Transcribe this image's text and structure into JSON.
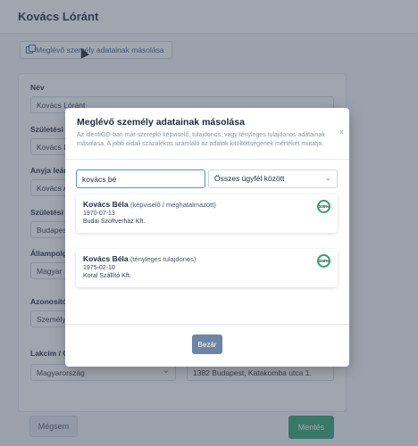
{
  "page": {
    "title": "Kovács Lóránt",
    "copy_button_label": "Meglévő személy adatainak másolása"
  },
  "form": {
    "fields": [
      {
        "label": "Név",
        "value": "Kovács Lóránt"
      },
      {
        "label": "Születési ne",
        "value": "Kovács Lo"
      },
      {
        "label": "Anyja leány",
        "value": "Kovács A"
      },
      {
        "label": "Születési he",
        "value": "Budapest"
      },
      {
        "label": "Állampolgá",
        "value": "Magyar"
      },
      {
        "label": "Azonosító d",
        "value": "Személyi"
      }
    ],
    "address": {
      "label": "Lakcím / O",
      "country": "Magyarország",
      "street": "1382 Budapest, Katakomba utca 1."
    },
    "cancel_label": "Mégsem",
    "save_label": "Mentés"
  },
  "modal": {
    "title": "Meglévő személy adatainak másolása",
    "close_symbol": "×",
    "description": "Az identiGO-ban már szereplő képviselő, tulajdonos, vagy tényleges tulajdonos adatainak másolása. A jobb oldali százalékos számláló az adatok kitöltöttségének mértékét mutatja.",
    "search_value": "kovács bé",
    "scope_value": "Összes ügyfél között",
    "results": [
      {
        "name": "Kovács Béla",
        "role": "(képviselő / meghatalmazott)",
        "date": "1970-07-13",
        "company": "Budai Szoftverház Kft.",
        "percent": "100%"
      },
      {
        "name": "Kovács Béla",
        "role": "(tényleges tulajdonos)",
        "date": "1975-02-10",
        "company": "Koral Szállító Kft.",
        "percent": "100%"
      }
    ],
    "close_button_label": "Bezár"
  },
  "colors": {
    "accent": "#2ca36a",
    "primary_button": "#6c84a6",
    "focus_border": "#5b8ad6"
  }
}
